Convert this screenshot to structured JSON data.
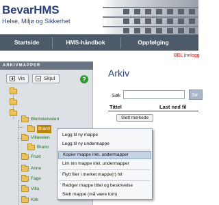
{
  "header": {
    "title": "BevarHMS",
    "subtitle": "Helse, Miljø og Sikkerhet"
  },
  "nav": {
    "items": [
      {
        "label": "Startside"
      },
      {
        "label": "HMS-håndbok"
      },
      {
        "label": "Oppfølging"
      }
    ],
    "alert": "BBL innlogg"
  },
  "sidebar": {
    "title": "ARKIVMAPPER",
    "show_button": "Vis",
    "hide_button": "Skjul",
    "help_symbol": "?",
    "tree": {
      "blomsterveien": "Blomsterveien",
      "selected": "Brann",
      "villaveien": "Villaveien",
      "brann2": "Brann",
      "frukt": "Frukt",
      "anne": "Anne",
      "fage": "Fage",
      "villa": "Villa",
      "kirk": "Kirk"
    }
  },
  "main": {
    "title": "Arkiv",
    "search_label": "Søk",
    "search_value": "",
    "search_button": "Sø",
    "columns": [
      "Tittel",
      "Last ned fil"
    ],
    "delete_button": "Slett merkede"
  },
  "context_menu": {
    "items": [
      {
        "label": "Legg til ny mappe"
      },
      {
        "label": "Legg til ny undermappe"
      },
      {
        "label": "Kopier mappe inkl. undermapper"
      },
      {
        "label": "Lim inn mappe inkl. undermapper"
      },
      {
        "label": "Flytt filer i merket mappe(r) hit"
      },
      {
        "label": "Rediger mappe tittel og beskrivelse"
      },
      {
        "label": "Slett mappe (må være tom)"
      }
    ]
  },
  "colors": {
    "brand": "#2b3f77",
    "nav": "#4d5a69",
    "alert": "#cc1111",
    "tree_label": "#1a6f1a",
    "selected": "#b8860b",
    "menu_highlight": "#c5d3e6"
  }
}
